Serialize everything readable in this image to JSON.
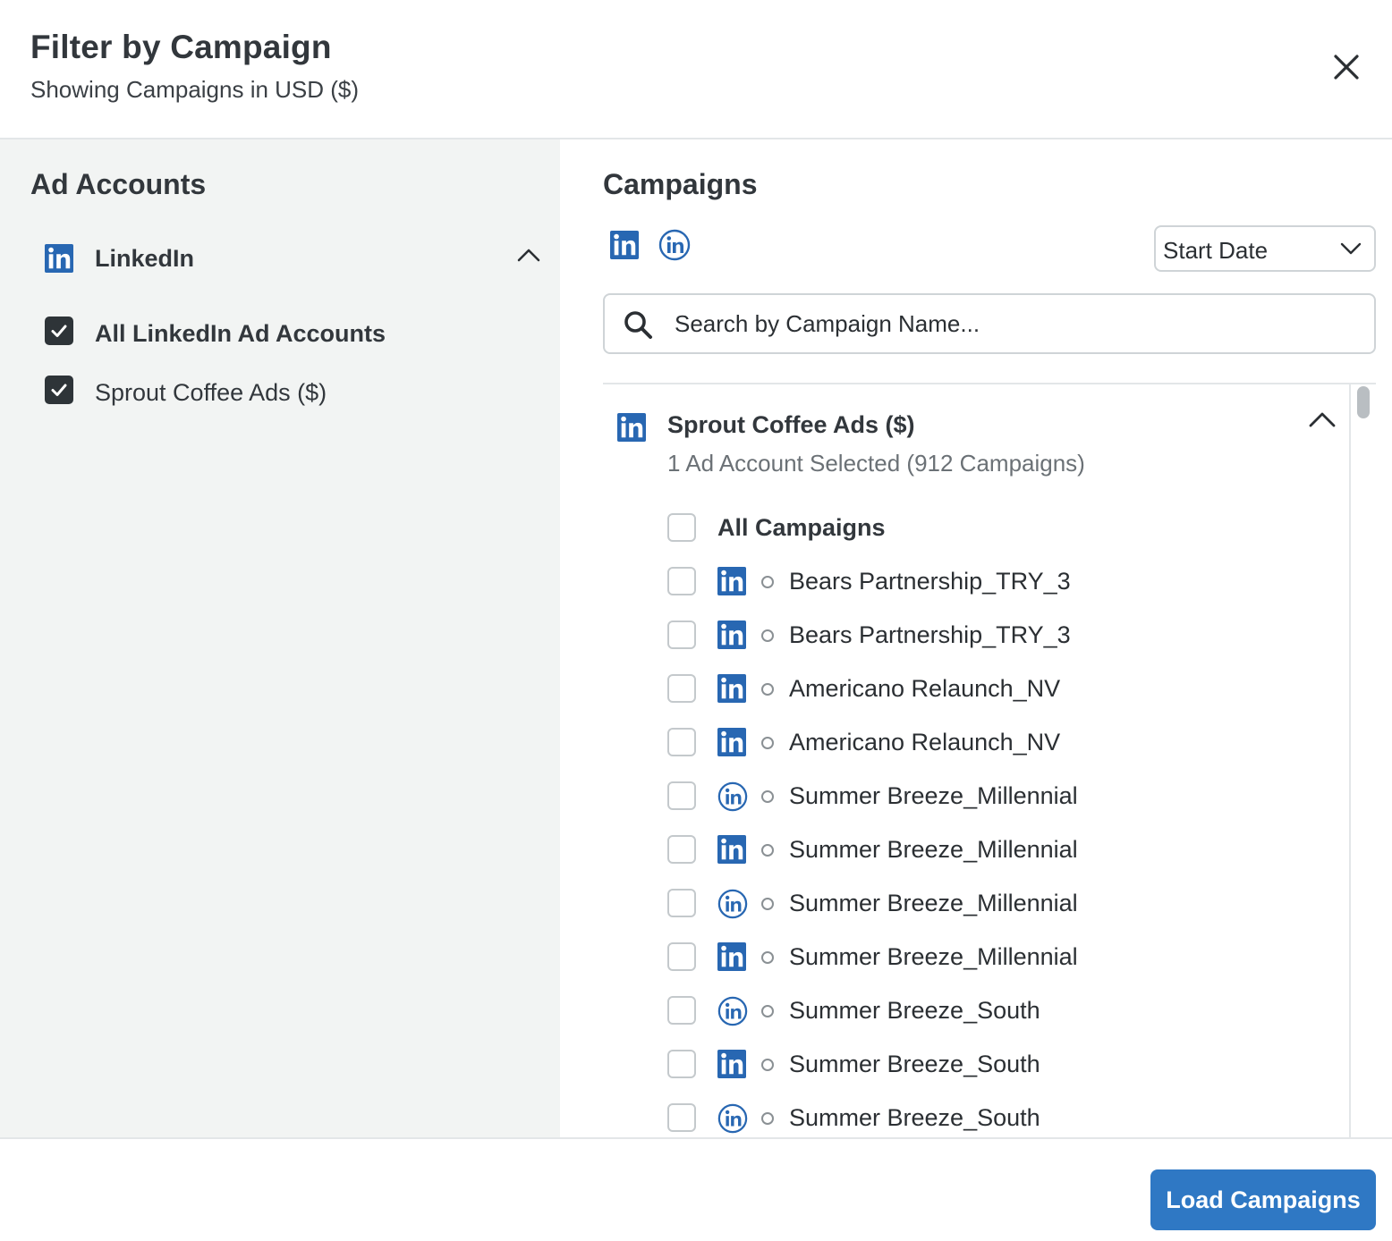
{
  "dialog": {
    "title": "Filter by Campaign",
    "subtitle": "Showing Campaigns in USD ($)"
  },
  "ad_accounts": {
    "heading": "Ad Accounts",
    "network": {
      "name": "LinkedIn",
      "icon": "linkedin-icon",
      "expanded": true
    },
    "items": [
      {
        "label": "All LinkedIn Ad Accounts",
        "checked": true,
        "bold": true
      },
      {
        "label": "Sprout Coffee Ads ($)",
        "checked": true,
        "bold": false
      }
    ]
  },
  "campaigns": {
    "heading": "Campaigns",
    "network_filters": [
      "linkedin-square-icon",
      "linkedin-circle-icon"
    ],
    "sort": {
      "selected": "Start Date"
    },
    "search": {
      "placeholder": "Search by Campaign Name...",
      "value": ""
    },
    "group": {
      "title": "Sprout Coffee Ads ($)",
      "subtitle": "1 Ad Account Selected (912 Campaigns)",
      "expanded": true,
      "all_label": "All Campaigns",
      "items": [
        {
          "label": "Bears Partnership_TRY_3",
          "icon": "square",
          "checked": false
        },
        {
          "label": "Bears Partnership_TRY_3",
          "icon": "square",
          "checked": false
        },
        {
          "label": "Americano Relaunch_NV",
          "icon": "square",
          "checked": false
        },
        {
          "label": "Americano Relaunch_NV",
          "icon": "square",
          "checked": false
        },
        {
          "label": "Summer Breeze_Millennial",
          "icon": "circle",
          "checked": false
        },
        {
          "label": "Summer Breeze_Millennial",
          "icon": "square",
          "checked": false
        },
        {
          "label": "Summer Breeze_Millennial",
          "icon": "circle",
          "checked": false
        },
        {
          "label": "Summer Breeze_Millennial",
          "icon": "square",
          "checked": false
        },
        {
          "label": "Summer Breeze_South",
          "icon": "circle",
          "checked": false
        },
        {
          "label": "Summer Breeze_South",
          "icon": "square",
          "checked": false
        },
        {
          "label": "Summer Breeze_South",
          "icon": "circle",
          "checked": false
        }
      ]
    }
  },
  "footer": {
    "primary_label": "Load Campaigns"
  },
  "colors": {
    "linkedin_blue": "#2867b2",
    "primary_button": "#2f78c4",
    "left_panel_bg": "#f2f4f3",
    "checkbox_checked": "#2e3438"
  }
}
